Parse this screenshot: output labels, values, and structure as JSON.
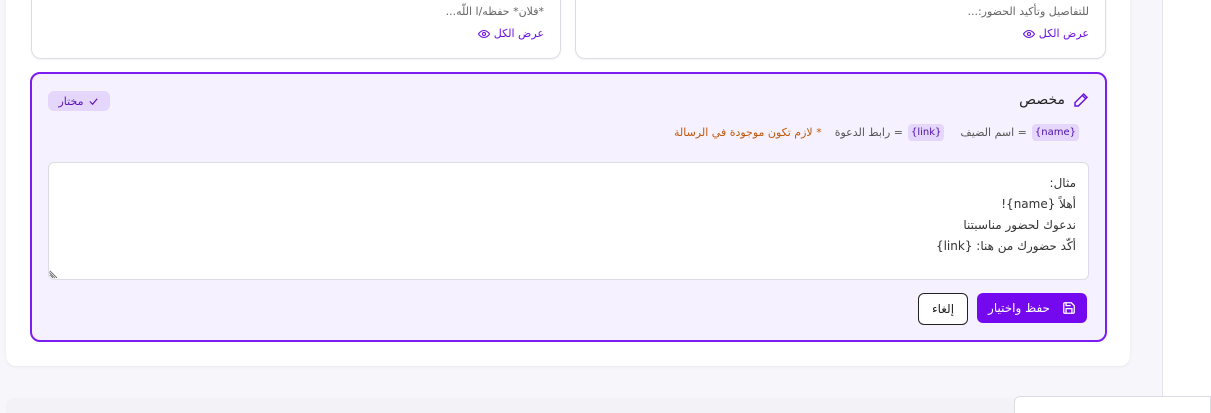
{
  "templates": [
    {
      "preview": "*فلان* حفظه/ا اللّه...",
      "view_all": "عرض الكل"
    },
    {
      "preview": "للتفاصيل وتأكيد الحضور:...",
      "view_all": "عرض الكل"
    }
  ],
  "custom": {
    "title": "مخصص",
    "selected_badge": "مختار",
    "vars": {
      "name_chip": "{name}",
      "name_desc": "= اسم الضيف",
      "link_chip": "{link}",
      "link_desc": "= رابط الدعوة",
      "warning": "* لازم تكون موجودة في الرسالة"
    },
    "message": "مثال:\nأهلاً {name}!\nندعوك لحضور مناسبتنا\nأكّد حضورك من هنا: {link}",
    "save_label": "حفظ واختيار",
    "cancel_label": "إلغاء"
  },
  "colors": {
    "accent": "#7409f0",
    "selected_bg": "#f6f1ff",
    "warning": "#c2590a"
  },
  "icons": {
    "eye": "eye-icon",
    "pencil": "pencil-icon",
    "check": "check-icon",
    "save": "save-icon"
  }
}
